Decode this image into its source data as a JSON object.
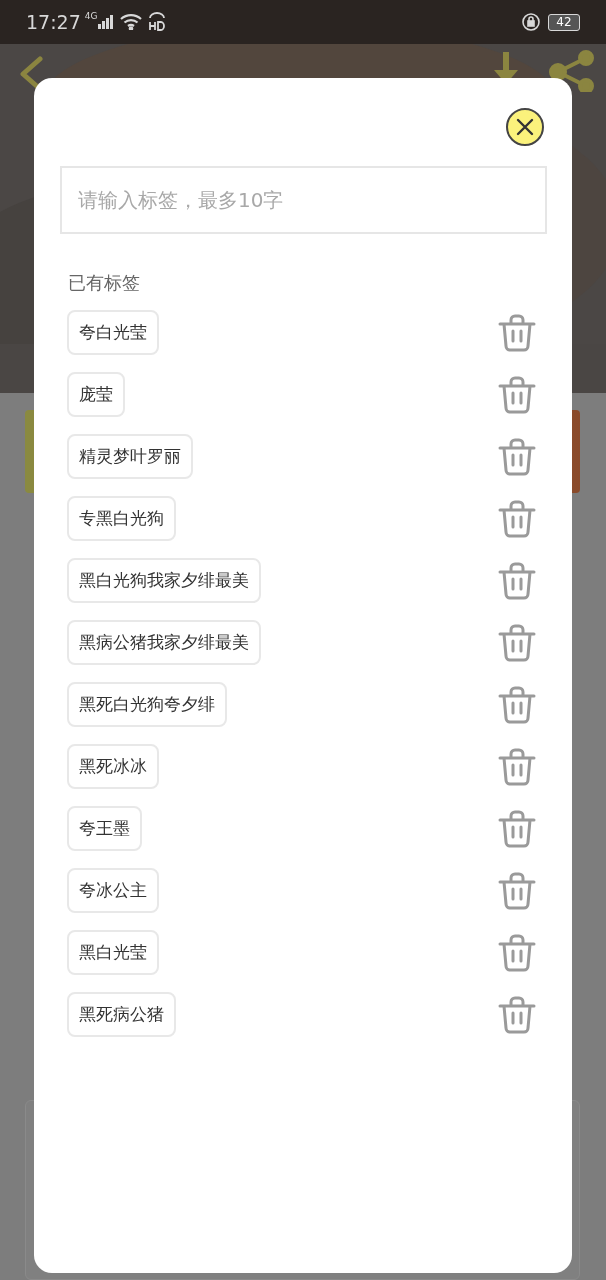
{
  "status_bar": {
    "time": "17:27",
    "network": "4G",
    "battery": "42"
  },
  "dialog": {
    "input": {
      "placeholder": "请输入标签，最多10字"
    },
    "section_title": "已有标签",
    "tags": [
      {
        "label": "夸白光莹"
      },
      {
        "label": "庞莹"
      },
      {
        "label": "精灵梦叶罗丽"
      },
      {
        "label": "专黑白光狗"
      },
      {
        "label": "黑白光狗我家夕绯最美"
      },
      {
        "label": "黑病公猪我家夕绯最美"
      },
      {
        "label": "黑死白光狗夸夕绯"
      },
      {
        "label": "黑死冰冰"
      },
      {
        "label": "夸王墨"
      },
      {
        "label": "夸冰公主"
      },
      {
        "label": "黑白光莹"
      },
      {
        "label": "黑死病公猪"
      }
    ]
  }
}
